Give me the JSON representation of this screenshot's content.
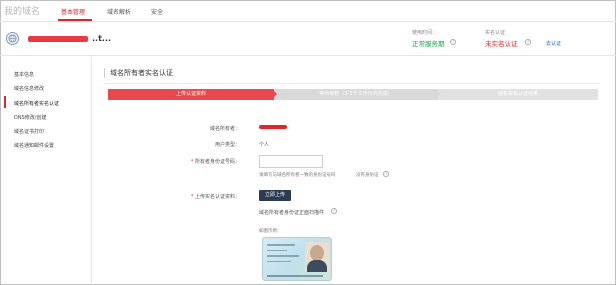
{
  "brand": "我的域名",
  "nav": {
    "items": [
      {
        "label": "基本管理",
        "active": true
      },
      {
        "label": "域名解析",
        "active": false
      },
      {
        "label": "安全",
        "active": false
      }
    ]
  },
  "domain": {
    "name": "..t..."
  },
  "status": {
    "service_label": "使用时间：",
    "service_value": "正常服务期",
    "realname_label": "实名认证",
    "realname_value": "未实名认证",
    "go_link": "去认证"
  },
  "sidebar": {
    "items": [
      {
        "label": "基本信息"
      },
      {
        "label": "域名信息修改"
      },
      {
        "label": "域名所有者实名认证"
      },
      {
        "label": "DNS修改/创建"
      },
      {
        "label": "域名证书打印"
      },
      {
        "label": "域名通知邮件设置"
      }
    ]
  },
  "page": {
    "title": "域名所有者实名认证"
  },
  "steps": [
    {
      "label": "上传认证资料"
    },
    {
      "label": "等待审核（3-5个工作日内完成）"
    },
    {
      "label": "域名实名认证结果"
    }
  ],
  "form": {
    "owner_label": "域名所有者：",
    "user_type_label": "用户类型：",
    "user_type_value": "个人",
    "id_label": "所有者身份证号码：",
    "id_hint": "请填写与域名所有者一致的身份证号码",
    "no_id_link": "没有身份证",
    "upload_label": "上传实名认证资料：",
    "upload_button": "立即上传",
    "upload_hint": "域名所有者身份证正面扫描件",
    "example_label": "如图示例："
  },
  "colors": {
    "accent": "#e0262a",
    "step_active": "#e8494f",
    "step_inactive": "#d9d9d9",
    "button": "#2b3b52",
    "ok": "#1aa34a",
    "link": "#2a6ebb"
  }
}
